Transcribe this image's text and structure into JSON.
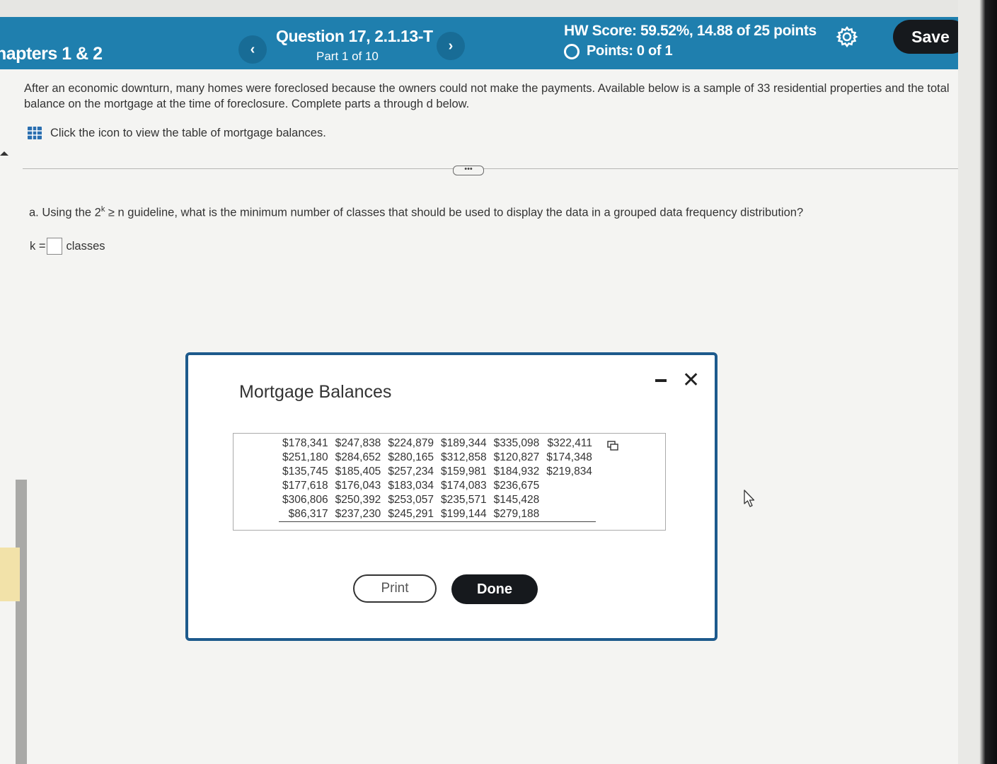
{
  "header": {
    "chapter_title": "hapters 1 & 2",
    "question_title": "Question 17, 2.1.13-T",
    "question_part": "Part 1 of 10",
    "hw_score": "HW Score: 59.52%, 14.88 of 25 points",
    "points": "Points: 0 of 1",
    "prev_glyph": "‹",
    "next_glyph": "›",
    "save_label": "Save",
    "icons": [
      "chevron-left-icon",
      "chevron-right-icon",
      "settings-gear-icon",
      "radio-circle-icon"
    ]
  },
  "content": {
    "intro": "After an economic downturn, many homes were foreclosed because the owners could not make the payments. Available below is a sample of 33 residential properties and the total balance on the mortgage at the time of foreclosure. Complete parts a through d below.",
    "table_link": "Click the icon to view the table of mortgage balances.",
    "expand_label": "•••",
    "question_a": {
      "before": "a. Using the 2",
      "sup": "k",
      "after": " ≥ n guideline, what is the minimum number of classes that should be used to display the data in a grouped data frequency distribution?"
    },
    "k_label": "k =",
    "k_value": "",
    "k_unit": "classes"
  },
  "modal": {
    "title": "Mortgage Balances",
    "minimize_glyph": "–",
    "close_glyph": "✕",
    "rows": [
      [
        "$178,341",
        "$247,838",
        "$224,879",
        "$189,344",
        "$335,098",
        "$322,411"
      ],
      [
        "$251,180",
        "$284,652",
        "$280,165",
        "$312,858",
        "$120,827",
        "$174,348"
      ],
      [
        "$135,745",
        "$185,405",
        "$257,234",
        "$159,981",
        "$184,932",
        "$219,834"
      ],
      [
        "$177,618",
        "$176,043",
        "$183,034",
        "$174,083",
        "$236,675",
        ""
      ],
      [
        "$306,806",
        "$250,392",
        "$253,057",
        "$235,571",
        "$145,428",
        ""
      ],
      [
        "$86,317",
        "$237,230",
        "$245,291",
        "$199,144",
        "$279,188",
        ""
      ]
    ],
    "print_label": "Print",
    "done_label": "Done"
  },
  "colors": {
    "header_bg": "#1f7fae",
    "save_bg": "#16191d",
    "modal_border": "#1d5a8c"
  }
}
